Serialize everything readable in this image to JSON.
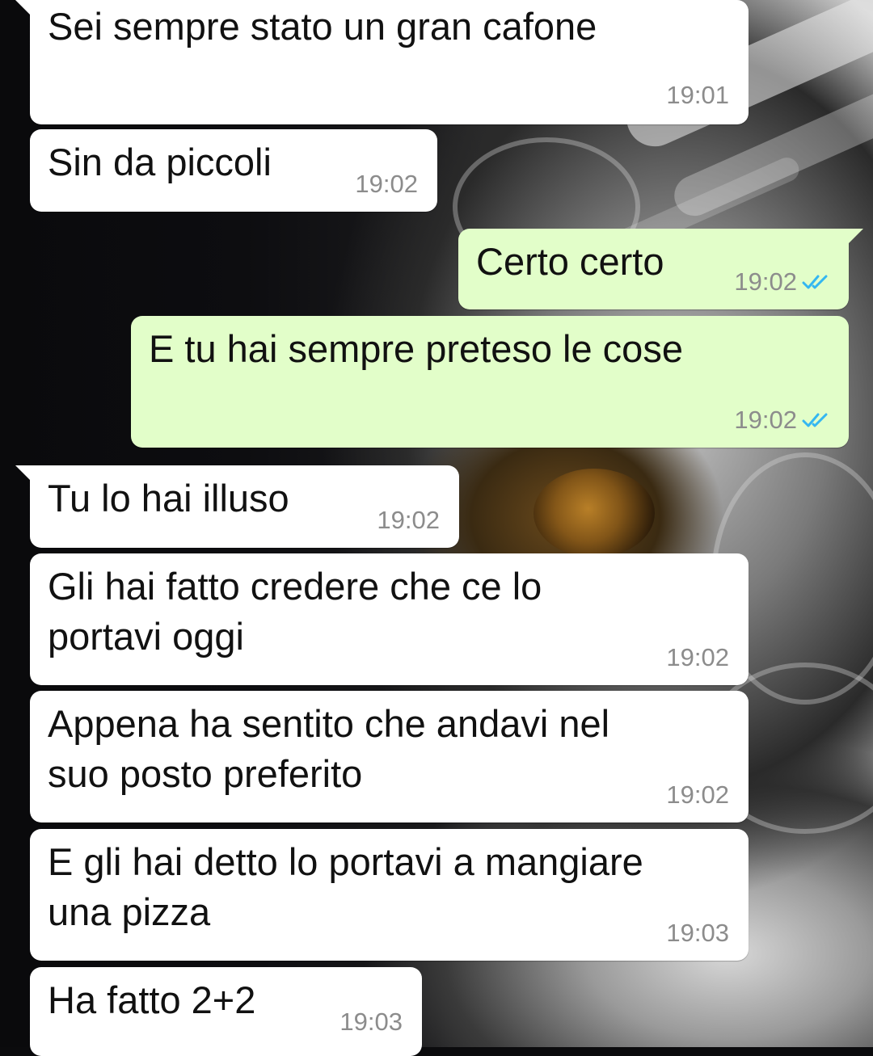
{
  "theme": {
    "incoming_bubble": "#ffffff",
    "outgoing_bubble": "#e2fec9",
    "time_color": "#8c8c8c",
    "read_check_color": "#34b7f1"
  },
  "messages": [
    {
      "direction": "in",
      "text": "Sei sempre stato un gran cafone",
      "time": "19:01"
    },
    {
      "direction": "in",
      "text": "Sin da piccoli",
      "time": "19:02"
    },
    {
      "direction": "out",
      "text": "Certo certo",
      "time": "19:02",
      "status_icon": "double-check-read"
    },
    {
      "direction": "out",
      "text": "E tu hai sempre preteso le cose",
      "time": "19:02",
      "status_icon": "double-check-read"
    },
    {
      "direction": "in",
      "text": "Tu lo hai illuso",
      "time": "19:02"
    },
    {
      "direction": "in",
      "text": "Gli hai fatto credere che ce lo\nportavi oggi",
      "time": "19:02"
    },
    {
      "direction": "in",
      "text": "Appena ha sentito che andavi nel\nsuo posto preferito",
      "time": "19:02"
    },
    {
      "direction": "in",
      "text": "E gli hai detto lo portavi a mangiare\nuna pizza",
      "time": "19:03"
    },
    {
      "direction": "in",
      "text": "Ha fatto 2+2",
      "time": "19:03"
    }
  ]
}
